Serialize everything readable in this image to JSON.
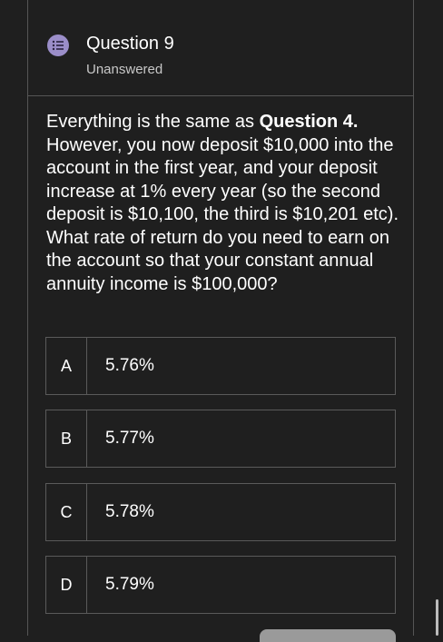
{
  "question": {
    "title": "Question 9",
    "status": "Unanswered",
    "icon": "list-icon",
    "icon_color": "#9b8ec9"
  },
  "prompt": {
    "text_before": "Everything is the same as ",
    "bold_ref": "Question 4.",
    "text_after": " However, you now deposit $10,000 into the account in the first year, and your deposit increase at 1% every year (so the second deposit is $10,100, the third is $10,201 etc). What rate of return do you need to earn on the account so that your constant annual annuity income is $100,000?"
  },
  "options": [
    {
      "letter": "A",
      "text": "5.76%"
    },
    {
      "letter": "B",
      "text": "5.77%"
    },
    {
      "letter": "C",
      "text": "5.78%"
    },
    {
      "letter": "D",
      "text": "5.79%"
    }
  ],
  "colors": {
    "background": "#1f1f1f",
    "border": "#555555",
    "text": "#ffffff",
    "muted_text": "#c8c8c8"
  }
}
